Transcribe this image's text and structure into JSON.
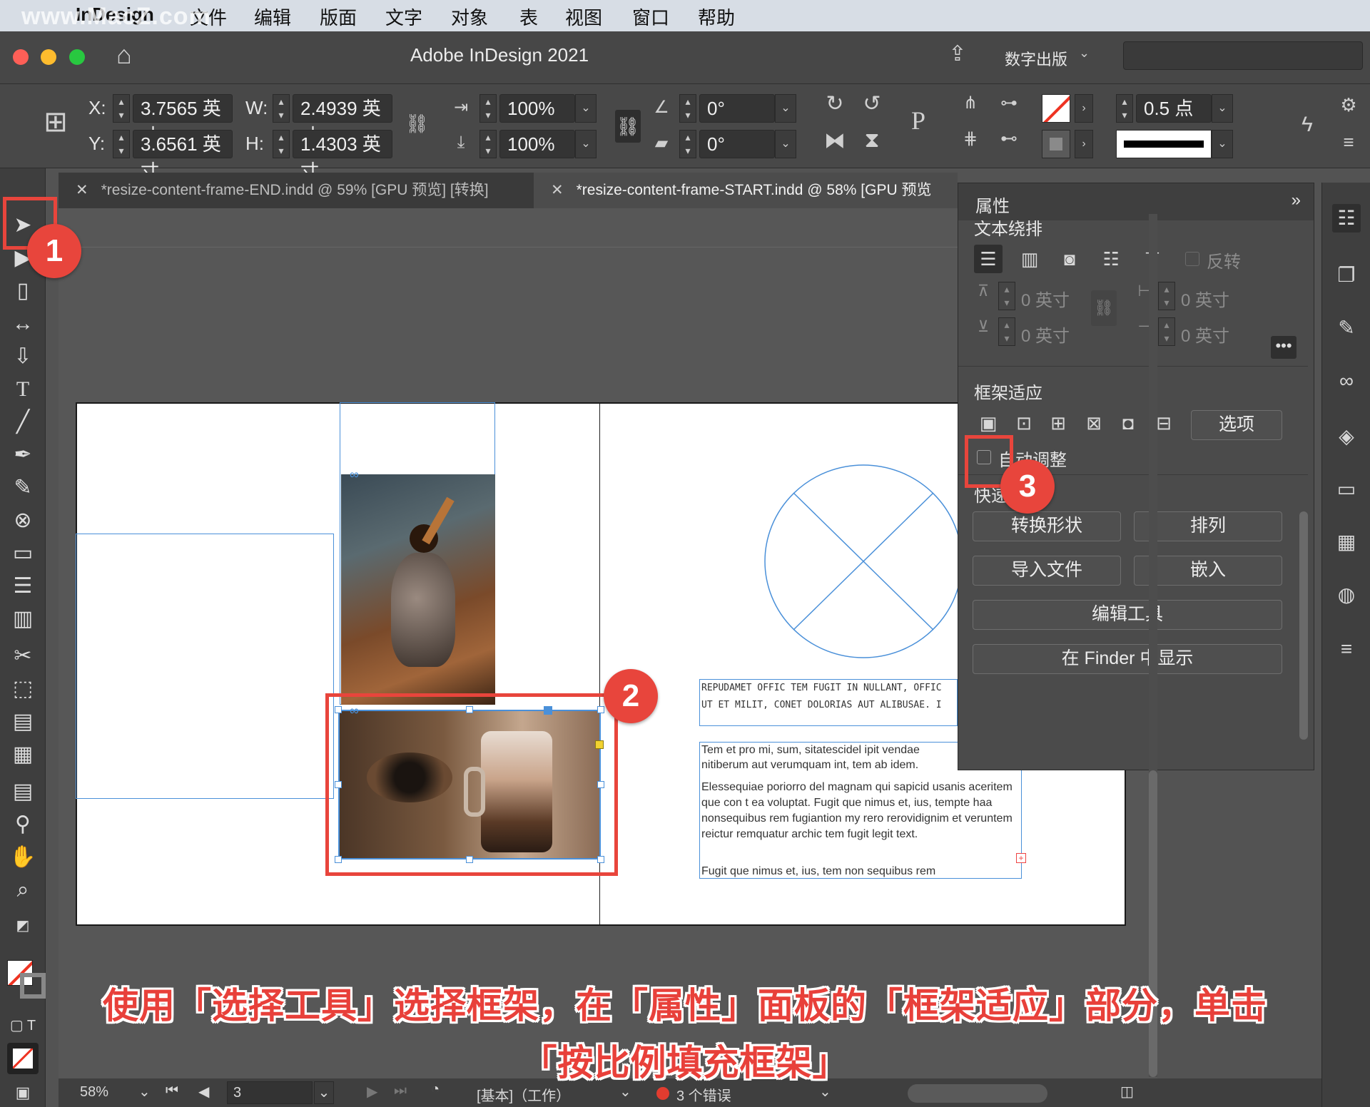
{
  "menubar": {
    "watermark": "www.MacZ.com",
    "items": [
      "InDesign",
      "文件",
      "编辑",
      "版面",
      "文字",
      "对象",
      "表",
      "视图",
      "窗口",
      "帮助"
    ]
  },
  "window": {
    "title": "Adobe InDesign 2021",
    "workspace": "数字出版"
  },
  "control": {
    "x_label": "X:",
    "x_value": "3.7565 英寸",
    "y_label": "Y:",
    "y_value": "3.6561 英寸",
    "w_label": "W:",
    "w_value": "2.4939 英寸",
    "h_label": "H:",
    "h_value": "1.4303 英寸",
    "scale_x": "100%",
    "scale_y": "100%",
    "angle": "0°",
    "shear": "0°",
    "stroke_weight": "0.5 点"
  },
  "tabs": [
    {
      "label": "*resize-content-frame-END.indd @ 59% [GPU 预览] [转换]"
    },
    {
      "label": "*resize-content-frame-START.indd @ 58% [GPU 预览"
    }
  ],
  "page": {
    "text1_line1": "REPUDAMET OFFIC TEM FUGIT IN NULLANT, OFFIC",
    "text1_line2": "UT ET MILIT, CONET DOLORIAS AUT ALIBUSAE. I",
    "text2_p1": "Tem et pro mi, sum, sitatescidel ipit vendae nitiberum aut verumquam int, tem ab idem.",
    "text2_p2": "Elessequiae poriorro del magnam qui sapicid usanis aceritem que con t ea voluptat. Fugit que nimus et, ius, tempte haa nonsequibus rem fugiantion my rero rerovidignim et veruntem reictur remquatur archic tem fugit legit text.",
    "text2_p3": "Fugit que nimus et, ius, tem non sequibus rem"
  },
  "properties": {
    "title": "属性",
    "text_wrap_heading": "文本绕排",
    "invert_label": "反转",
    "offset_top": "0 英寸",
    "offset_bottom": "0 英寸",
    "offset_left": "0 英寸",
    "offset_right": "0 英寸",
    "frame_fitting_heading": "框架适应",
    "options_button": "选项",
    "auto_fit_label": "自动调整",
    "quick_actions_heading": "快速操作",
    "btn_convert_shape": "转换形状",
    "btn_arrange": "排列",
    "btn_place": "导入文件",
    "btn_embed": "嵌入",
    "btn_edit_tool": "编辑工具",
    "btn_reveal_finder": "在 Finder 中显示"
  },
  "status": {
    "zoom": "58%",
    "page_num": "3",
    "profile": "[基本]（工作）",
    "errors": "3 个错误"
  },
  "callouts": {
    "badge1": "1",
    "badge2": "2",
    "badge3": "3"
  },
  "caption": {
    "line1": "使用「选择工具」选择框架，在「属性」面板的「框架适应」部分，单击",
    "line2": "「按比例填充框架」"
  },
  "colors": {
    "callout_red": "#e8453c",
    "frame_blue": "#4a90d9",
    "error_dot": "#e23c2f"
  }
}
